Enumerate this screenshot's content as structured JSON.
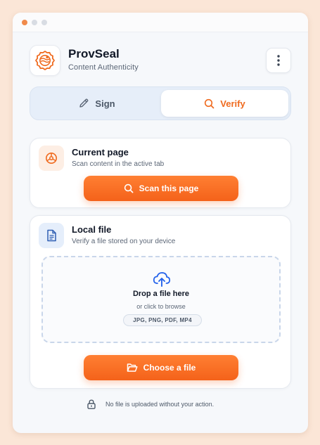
{
  "app": {
    "name": "ProvSeal",
    "subtitle": "Content Authenticity"
  },
  "tabs": [
    {
      "label": "Sign",
      "icon": "pencil-icon",
      "active": false
    },
    {
      "label": "Verify",
      "icon": "search-icon",
      "active": true
    }
  ],
  "current_page": {
    "title": "Current page",
    "subtitle": "Scan content in the active tab",
    "button_label": "Scan this page"
  },
  "local_file": {
    "title": "Local file",
    "subtitle": "Verify a file stored on your device",
    "dropzone": {
      "title": "Drop a file here",
      "subtitle": "or click to browse",
      "formats": "JPG, PNG, PDF, MP4"
    },
    "button_label": "Choose a file"
  },
  "footer": {
    "note": "No file is uploaded without your action."
  },
  "colors": {
    "accent": "#f4621a",
    "accent_light": "#fdeee4",
    "info_blue": "#2563eb"
  }
}
